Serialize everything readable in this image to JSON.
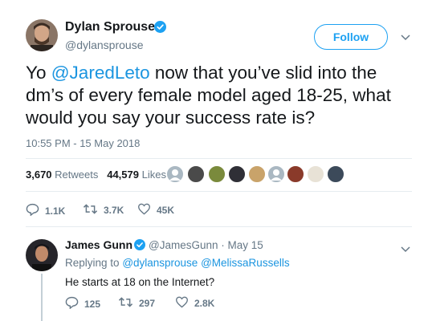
{
  "tweet": {
    "author_name": "Dylan Sprouse",
    "author_handle": "@dylansprouse",
    "follow_label": "Follow",
    "text_prefix": "Yo ",
    "text_mention": "@JaredLeto",
    "text_rest": " now that you’ve slid into the dm’s of every female model aged 18-25, what would you say your success rate is?",
    "timestamp": "10:55 PM - 15 May 2018",
    "retweets_count": "3,670",
    "retweets_label": "Retweets",
    "likes_count": "44,579",
    "likes_label": "Likes",
    "reply_count": "1.1K",
    "retweet_action_count": "3.7K",
    "like_action_count": "45K"
  },
  "reply": {
    "author_name": "James Gunn",
    "handle_and_date": "@JamesGunn · May 15",
    "replying_prefix": "Replying to",
    "replying_mention_1": "@dylansprouse",
    "replying_mention_2": "@MelissaRussells",
    "text": "He starts at 18 on the Internet?",
    "reply_count": "125",
    "retweet_count": "297",
    "like_count": "2.8K"
  },
  "colors": {
    "accent_blue": "#1da1f2",
    "mention_blue": "#1b95e0",
    "muted_gray": "#657786"
  },
  "icons": [
    "verified-badge-icon",
    "chevron-down-icon",
    "reply-icon",
    "retweet-icon",
    "like-heart-icon"
  ]
}
